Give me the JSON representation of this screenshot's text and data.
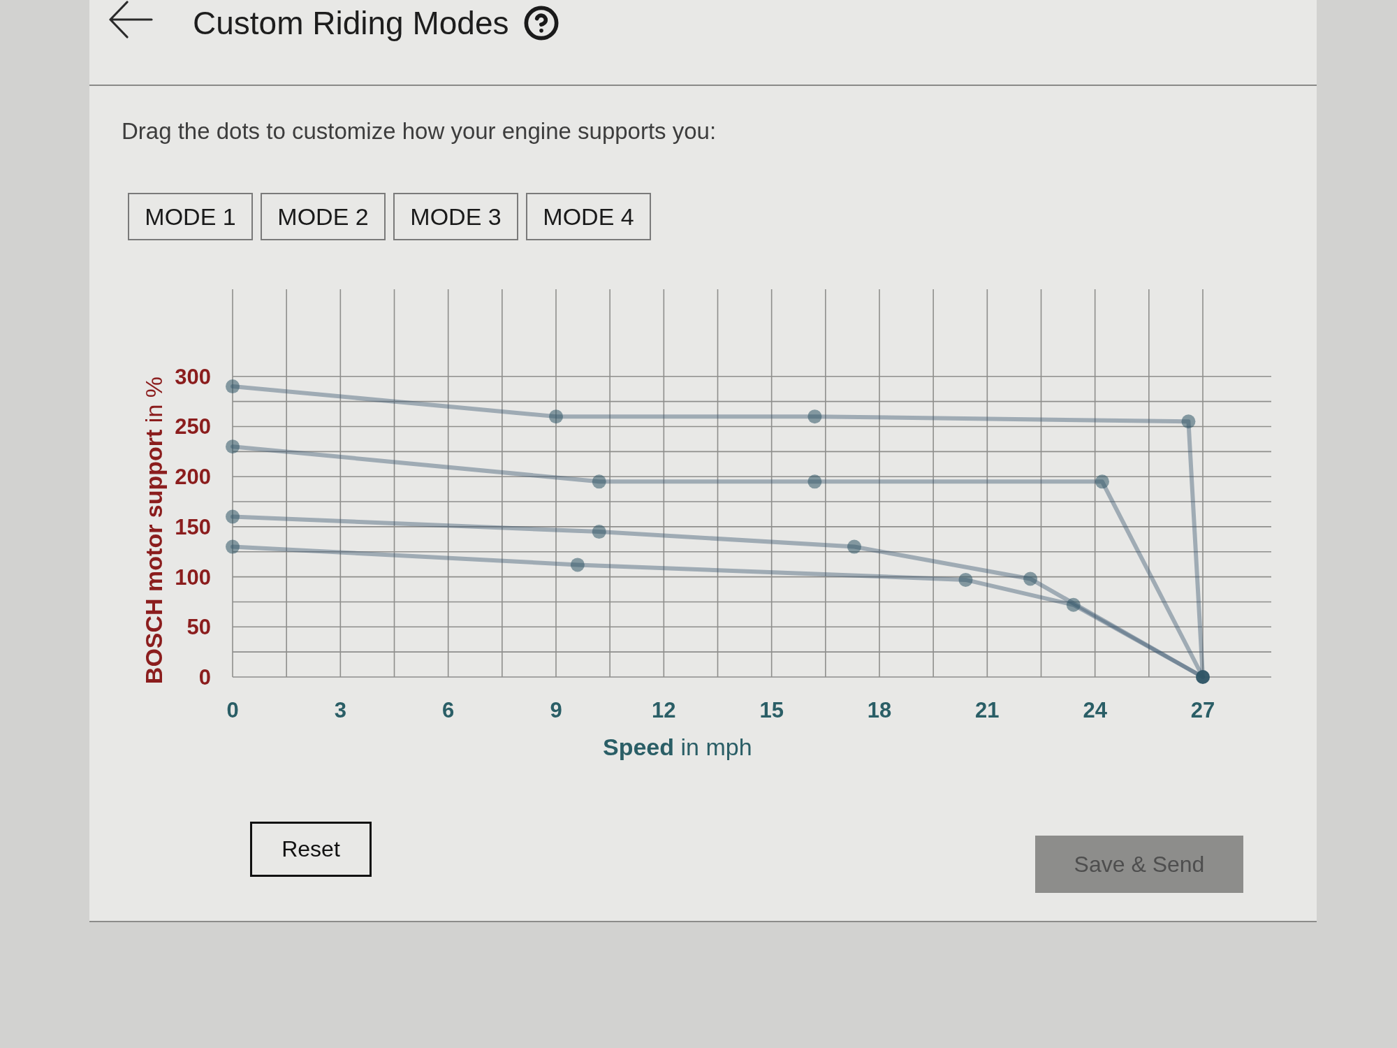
{
  "header": {
    "title": "Custom Riding Modes"
  },
  "instruction": "Drag the dots to customize how your engine supports you:",
  "modes": [
    {
      "label": "MODE 1"
    },
    {
      "label": "MODE 2"
    },
    {
      "label": "MODE 3"
    },
    {
      "label": "MODE 4"
    }
  ],
  "chart": {
    "chart_data": {
      "type": "line",
      "xlabel": "**Speed** in mph",
      "ylabel": "**BOSCH motor support** in %",
      "xlim": [
        0,
        27
      ],
      "ylim": [
        0,
        387
      ],
      "xticks": [
        0,
        3,
        6,
        9,
        12,
        15,
        18,
        21,
        24,
        27
      ],
      "yticks": [
        0,
        50,
        100,
        150,
        200,
        250,
        300
      ],
      "grid": true,
      "series": [
        {
          "x": [
            0,
            9,
            16.2,
            26.6,
            27
          ],
          "values": [
            290,
            260,
            260,
            255,
            0
          ],
          "marker": "circle"
        },
        {
          "x": [
            0,
            10.2,
            16.2,
            24.2,
            27
          ],
          "values": [
            230,
            195,
            195,
            195,
            0
          ],
          "marker": "circle"
        },
        {
          "x": [
            0,
            10.2,
            17.3,
            22.2,
            27
          ],
          "values": [
            160,
            145,
            130,
            98,
            0
          ],
          "marker": "circle"
        },
        {
          "x": [
            0,
            9.6,
            20.4,
            23.4,
            27
          ],
          "values": [
            130,
            112,
            97,
            72,
            0
          ],
          "marker": "circle"
        }
      ]
    }
  },
  "buttons": [
    {
      "label": "Reset",
      "kind": "outline",
      "disabled": false
    },
    {
      "label": "Save & Send",
      "kind": "filled",
      "disabled": true
    }
  ]
}
